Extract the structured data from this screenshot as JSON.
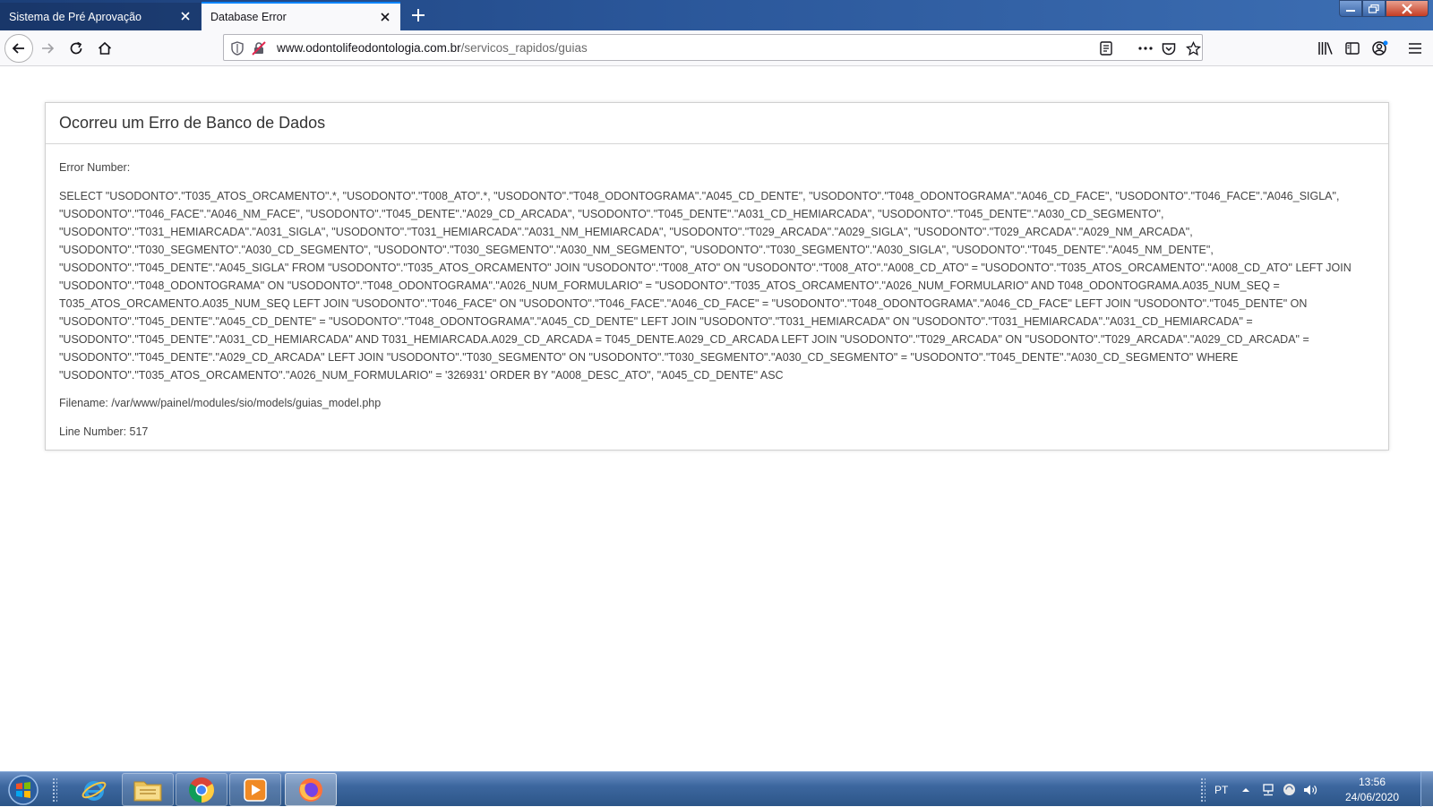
{
  "browser": {
    "tabs": [
      {
        "title": "Sistema de Pré Aprovação",
        "active": false
      },
      {
        "title": "Database Error",
        "active": true
      }
    ],
    "url_domain": "www.odontolifeodontologia.com.br",
    "url_path": "/servicos_rapidos/guias"
  },
  "page": {
    "heading": "Ocorreu um Erro de Banco de Dados",
    "error_number": "Error Number:",
    "sql": "SELECT \"USODONTO\".\"T035_ATOS_ORCAMENTO\".*, \"USODONTO\".\"T008_ATO\".*, \"USODONTO\".\"T048_ODONTOGRAMA\".\"A045_CD_DENTE\", \"USODONTO\".\"T048_ODONTOGRAMA\".\"A046_CD_FACE\", \"USODONTO\".\"T046_FACE\".\"A046_SIGLA\", \"USODONTO\".\"T046_FACE\".\"A046_NM_FACE\", \"USODONTO\".\"T045_DENTE\".\"A029_CD_ARCADA\", \"USODONTO\".\"T045_DENTE\".\"A031_CD_HEMIARCADA\", \"USODONTO\".\"T045_DENTE\".\"A030_CD_SEGMENTO\", \"USODONTO\".\"T031_HEMIARCADA\".\"A031_SIGLA\", \"USODONTO\".\"T031_HEMIARCADA\".\"A031_NM_HEMIARCADA\", \"USODONTO\".\"T029_ARCADA\".\"A029_SIGLA\", \"USODONTO\".\"T029_ARCADA\".\"A029_NM_ARCADA\", \"USODONTO\".\"T030_SEGMENTO\".\"A030_CD_SEGMENTO\", \"USODONTO\".\"T030_SEGMENTO\".\"A030_NM_SEGMENTO\", \"USODONTO\".\"T030_SEGMENTO\".\"A030_SIGLA\", \"USODONTO\".\"T045_DENTE\".\"A045_NM_DENTE\", \"USODONTO\".\"T045_DENTE\".\"A045_SIGLA\" FROM \"USODONTO\".\"T035_ATOS_ORCAMENTO\" JOIN \"USODONTO\".\"T008_ATO\" ON \"USODONTO\".\"T008_ATO\".\"A008_CD_ATO\" = \"USODONTO\".\"T035_ATOS_ORCAMENTO\".\"A008_CD_ATO\" LEFT JOIN \"USODONTO\".\"T048_ODONTOGRAMA\" ON \"USODONTO\".\"T048_ODONTOGRAMA\".\"A026_NUM_FORMULARIO\" = \"USODONTO\".\"T035_ATOS_ORCAMENTO\".\"A026_NUM_FORMULARIO\" AND T048_ODONTOGRAMA.A035_NUM_SEQ = T035_ATOS_ORCAMENTO.A035_NUM_SEQ LEFT JOIN \"USODONTO\".\"T046_FACE\" ON \"USODONTO\".\"T046_FACE\".\"A046_CD_FACE\" = \"USODONTO\".\"T048_ODONTOGRAMA\".\"A046_CD_FACE\" LEFT JOIN \"USODONTO\".\"T045_DENTE\" ON \"USODONTO\".\"T045_DENTE\".\"A045_CD_DENTE\" = \"USODONTO\".\"T048_ODONTOGRAMA\".\"A045_CD_DENTE\" LEFT JOIN \"USODONTO\".\"T031_HEMIARCADA\" ON \"USODONTO\".\"T031_HEMIARCADA\".\"A031_CD_HEMIARCADA\" = \"USODONTO\".\"T045_DENTE\".\"A031_CD_HEMIARCADA\" AND T031_HEMIARCADA.A029_CD_ARCADA = T045_DENTE.A029_CD_ARCADA LEFT JOIN \"USODONTO\".\"T029_ARCADA\" ON \"USODONTO\".\"T029_ARCADA\".\"A029_CD_ARCADA\" = \"USODONTO\".\"T045_DENTE\".\"A029_CD_ARCADA\" LEFT JOIN \"USODONTO\".\"T030_SEGMENTO\" ON \"USODONTO\".\"T030_SEGMENTO\".\"A030_CD_SEGMENTO\" = \"USODONTO\".\"T045_DENTE\".\"A030_CD_SEGMENTO\" WHERE \"USODONTO\".\"T035_ATOS_ORCAMENTO\".\"A026_NUM_FORMULARIO\" = '326931' ORDER BY \"A008_DESC_ATO\", \"A045_CD_DENTE\" ASC",
    "filename": "Filename: /var/www/painel/modules/sio/models/guias_model.php",
    "line_number": "Line Number: 517"
  },
  "taskbar": {
    "pinned_apps": [
      "internet-explorer-icon",
      "file-explorer-icon",
      "chrome-icon",
      "media-player-icon",
      "firefox-icon"
    ],
    "language": "PT",
    "time": "13:56",
    "date": "24/06/2020"
  },
  "colors": {
    "tab_accent": "#0a84ff",
    "taskbar": "#3d679f",
    "titlebar": "#2a5699"
  }
}
